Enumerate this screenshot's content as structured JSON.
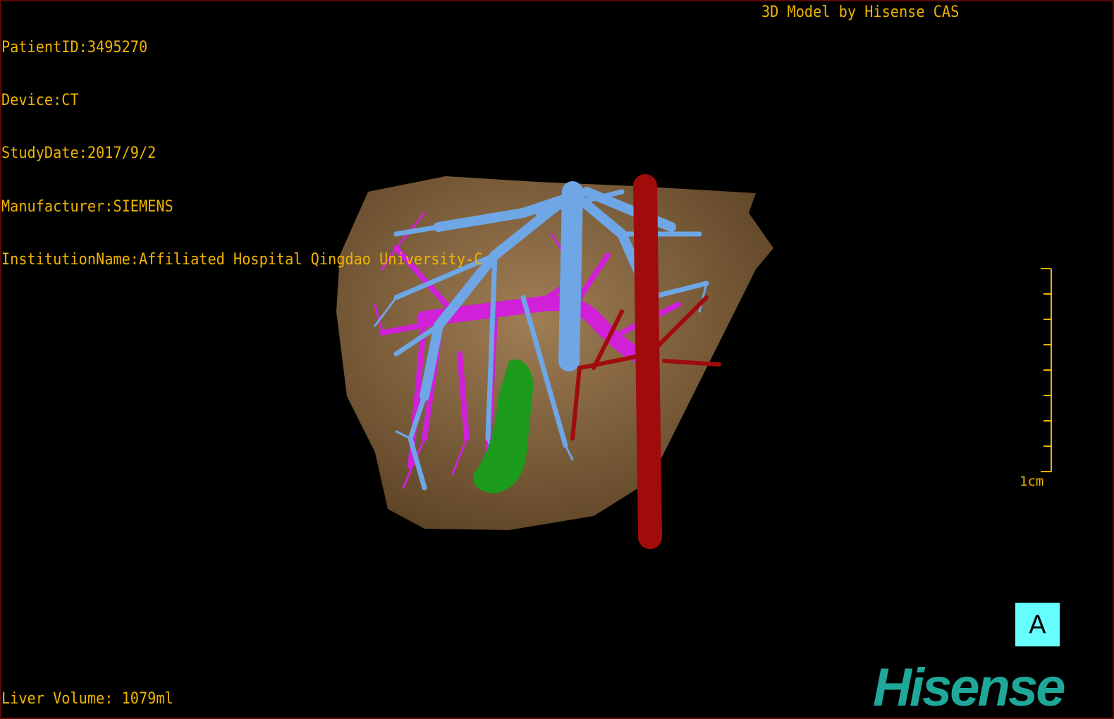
{
  "header": {
    "patient_id": "PatientID:3495270",
    "device": "Device:CT",
    "study_date": "StudyDate:2017/9/2",
    "manufacturer": "Manufacturer:SIEMENS",
    "institution": "InstitutionName:Affiliated Hospital Qingdao University-C",
    "credit": "3D Model by Hisense CAS"
  },
  "footer": {
    "liver_volume": "Liver Volume: 1079ml"
  },
  "scale_bar": {
    "label": "1cm"
  },
  "orientation": {
    "label": "A"
  },
  "logo": {
    "text": "Hisense"
  },
  "colors": {
    "text": "#f0b400",
    "liver": "#8a6a45",
    "hepatic_vein": "#6fa6e6",
    "portal_vein": "#d020d8",
    "artery_ivc": "#a00c0c",
    "gallbladder": "#1c9a1c",
    "orientation_box": "#66ffff",
    "logo": "#1fa89a"
  }
}
